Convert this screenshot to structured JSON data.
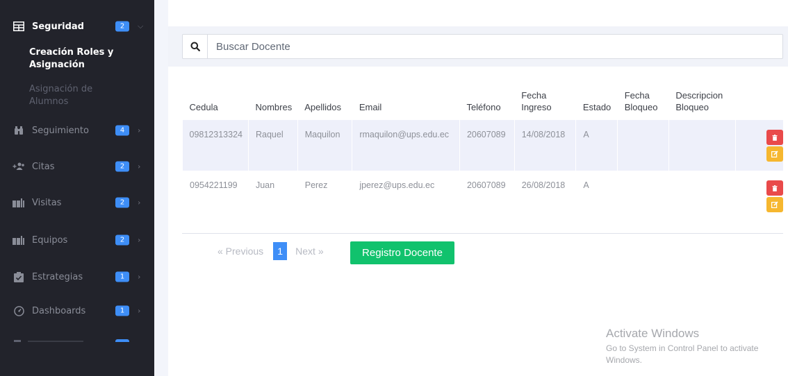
{
  "sidebar": {
    "groups": [
      {
        "label": "Seguridad",
        "badge": "2",
        "active": true
      },
      {
        "label": "Seguimiento",
        "badge": "4"
      },
      {
        "label": "Citas",
        "badge": "2"
      },
      {
        "label": "Visitas",
        "badge": "2"
      },
      {
        "label": "Equipos",
        "badge": "2"
      },
      {
        "label": "Estrategias",
        "badge": "1"
      },
      {
        "label": "Dashboards",
        "badge": "1"
      }
    ],
    "sub_items": [
      {
        "label": "Creación Roles y Asignación",
        "line1": "Creación Roles y",
        "line2": "Asignación"
      },
      {
        "label": "Asignación de Alumnos",
        "line1": "Asignación de",
        "line2": "Alumnos"
      }
    ]
  },
  "search": {
    "placeholder": "Buscar Docente"
  },
  "table": {
    "headers": [
      {
        "line1": "Cedula",
        "line2": ""
      },
      {
        "line1": "Nombres",
        "line2": ""
      },
      {
        "line1": "Apellidos",
        "line2": ""
      },
      {
        "line1": "Email",
        "line2": ""
      },
      {
        "line1": "Teléfono",
        "line2": ""
      },
      {
        "line1": "Fecha",
        "line2": "Ingreso"
      },
      {
        "line1": "Estado",
        "line2": ""
      },
      {
        "line1": "Fecha",
        "line2": "Bloqueo"
      },
      {
        "line1": "Descripcion",
        "line2": "Bloqueo"
      }
    ],
    "rows": [
      {
        "cedula": "09812313324",
        "nombres": "Raquel",
        "apellidos": "Maquilon",
        "email": "rmaquilon@ups.edu.ec",
        "telefono": "20607089",
        "fecha_ingreso": "14/08/2018",
        "estado": "A",
        "fecha_bloqueo": "",
        "descripcion_bloqueo": ""
      },
      {
        "cedula": "0954221199",
        "nombres": "Juan",
        "apellidos": "Perez",
        "email": "jperez@ups.edu.ec",
        "telefono": "20607089",
        "fecha_ingreso": "26/08/2018",
        "estado": "A",
        "fecha_bloqueo": "",
        "descripcion_bloqueo": ""
      }
    ]
  },
  "pagination": {
    "previous": "« Previous",
    "current": "1",
    "next": "Next »"
  },
  "register_button": "Registro Docente",
  "watermark": {
    "title": "Activate Windows",
    "subtitle": "Go to System in Control Panel to activate Windows."
  },
  "colors": {
    "sidebar_bg": "#22232b",
    "badge": "#3e8ef7",
    "primary_green": "#11c26d",
    "delete": "#e94a4a",
    "edit": "#f6b72f"
  }
}
